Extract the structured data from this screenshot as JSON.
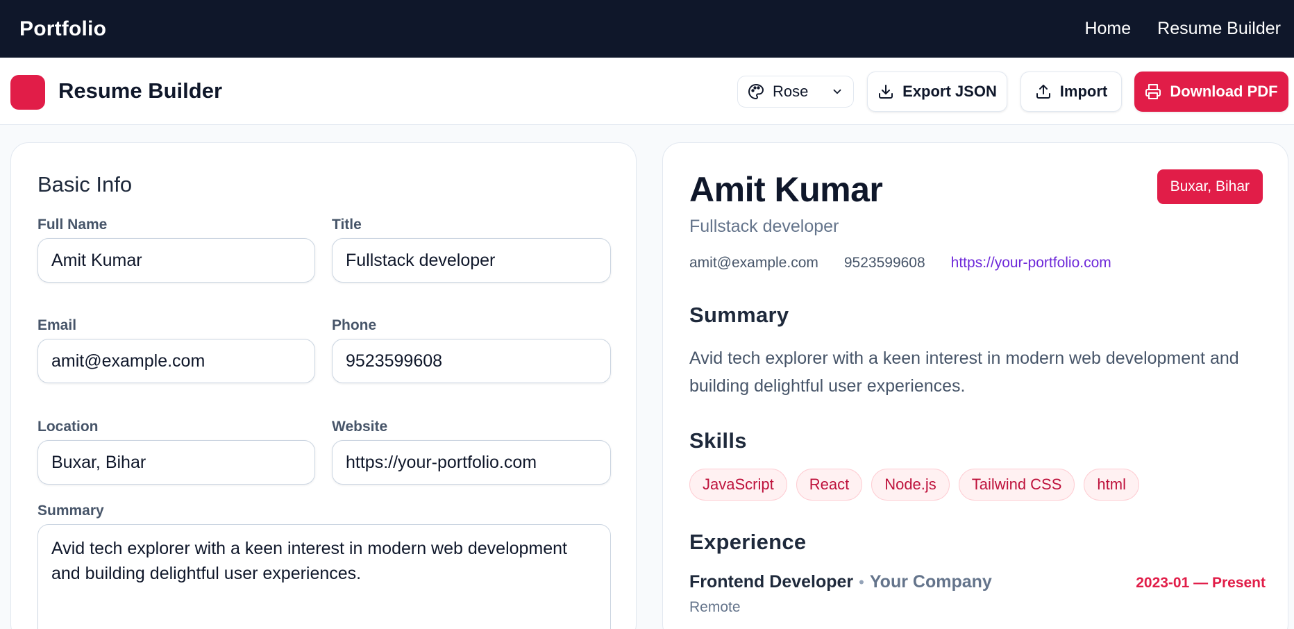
{
  "nav": {
    "brand": "Portfolio",
    "links": [
      "Home",
      "Resume Builder"
    ]
  },
  "toolbar": {
    "title": "Resume Builder",
    "theme": {
      "selected": "Rose",
      "icon": "palette-icon"
    },
    "export_label": "Export JSON",
    "import_label": "Import",
    "pdf_label": "Download PDF"
  },
  "colors": {
    "accent": "#e11d48",
    "nav_bg": "#0f172a",
    "link": "#6d28d9"
  },
  "form": {
    "heading": "Basic Info",
    "full_name": {
      "label": "Full Name",
      "value": "Amit Kumar"
    },
    "title": {
      "label": "Title",
      "value": "Fullstack developer"
    },
    "email": {
      "label": "Email",
      "value": "amit@example.com"
    },
    "phone": {
      "label": "Phone",
      "value": "9523599608"
    },
    "location": {
      "label": "Location",
      "value": "Buxar, Bihar"
    },
    "website": {
      "label": "Website",
      "value": "https://your-portfolio.com"
    },
    "summary": {
      "label": "Summary",
      "value": "Avid tech explorer with a keen interest in modern web development and building delightful user experiences."
    }
  },
  "preview": {
    "name": "Amit Kumar",
    "title": "Fullstack developer",
    "location_badge": "Buxar, Bihar",
    "email": "amit@example.com",
    "phone": "9523599608",
    "website": "https://your-portfolio.com",
    "summary_heading": "Summary",
    "summary": "Avid tech explorer with a keen interest in modern web development and building delightful user experiences.",
    "skills_heading": "Skills",
    "skills": [
      "JavaScript",
      "React",
      "Node.js",
      "Tailwind CSS",
      "html"
    ],
    "experience_heading": "Experience",
    "experience": [
      {
        "role": "Frontend Developer",
        "separator": "•",
        "company": "Your Company",
        "dates": "2023-01 — Present",
        "location": "Remote"
      }
    ]
  }
}
